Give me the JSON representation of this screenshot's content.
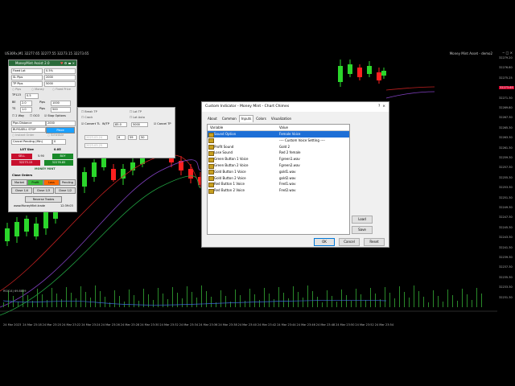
{
  "chart": {
    "header": "US30Rx,M1  32277.65 32277.55 32273.15 32273.65",
    "asset_title": "Money Mint Asset - demo2",
    "price_ticks": [
      "32279.20",
      "32276.80",
      "32275.25",
      "32273.65",
      "32271.30",
      "32269.80",
      "32267.30",
      "32265.30",
      "32263.30",
      "32261.30",
      "32259.30",
      "32257.30",
      "32255.30",
      "32253.30",
      "32251.30",
      "32249.30",
      "32247.30",
      "32245.30",
      "32243.30",
      "32241.30",
      "32239.30",
      "32237.30",
      "32235.30",
      "32233.30",
      "32231.30"
    ],
    "highlight_price": "32273.65",
    "time_ticks": [
      "24 Mar 2023",
      "24 Mar 23:18",
      "24 Mar 23:20",
      "24 Mar 23:22",
      "24 Mar 23:24",
      "24 Mar 23:26",
      "24 Mar 23:28",
      "24 Mar 23:30",
      "24 Mar 23:32",
      "24 Mar 23:34",
      "24 Mar 23:36",
      "24 Mar 23:38",
      "24 Mar 23:40",
      "24 Mar 23:42",
      "24 Mar 23:44",
      "24 Mar 23:46",
      "24 Mar 23:48",
      "24 Mar 23:50",
      "24 Mar 23:52",
      "24 Mar 23:54"
    ],
    "rsi_label": "RSI(14) 69.8809",
    "bull_color": "#2bd62b",
    "bear_color": "#ff2020"
  },
  "panel": {
    "title": "MoneyMint Assist 2.0",
    "fixed_lot_label": "Fixed Lot",
    "fixed_lot_value": "0.5%",
    "sl_label": "SL Pips",
    "sl_value": "2000",
    "tp_label": "TP Pips",
    "tp_value": "5000",
    "opt_pips": "Pips",
    "opt_money": "Money",
    "opt_fixed_price": "Fixed Price",
    "tp123_label": "TP123",
    "tp123_value": "0.5",
    "be_label": "BE",
    "be_value": "2.0",
    "pips_label": "Pips",
    "pips_value": "1000",
    "ts_label": "TS",
    "ts_value": "1.0",
    "pips2_value": "500",
    "two_way": "2 Way",
    "oco": "OCO",
    "stop_options": "Stop Options",
    "pips_distance_label": "Pips Distance",
    "pips_distance_value": "2000",
    "order_type": "BUY&SELL STOP",
    "place_label": "Place",
    "instant_order": "Instant Order",
    "schedule": "Schedule",
    "cancel_pending_label": "Cancel Pending (Min)",
    "cancel_pending_value": "0",
    "lot_size_label": "LOT Size",
    "lot_size_value": "0.05",
    "sell_label": "SELL",
    "spread": "5.90",
    "buy_label": "BUY",
    "sell_price": "32273.15",
    "buy_price": "32278.85",
    "close_orders_label": "Close Orders",
    "market_label": "Market",
    "profit_label": "Profit",
    "loss_label": "Loss",
    "pending_label": "Pending",
    "close_14": "Close 1/4",
    "close_13": "Close 1/3",
    "close_12": "Close 1/2",
    "reverse_trades": "Reverse Trades",
    "website": "www.MoneyMint.trade",
    "time": "12:39:03",
    "logo": "MONEY MINT"
  },
  "mini": {
    "break_tp": "Break TP",
    "cb2": "Crack",
    "cb3": "Lot TP",
    "cb4": "Lot Auto",
    "convert_tl": "Convert TL",
    "wtp_label": "W/TP",
    "wtp_value": "85.0",
    "v3": "5000",
    "cancel_tp": "Cancel TP",
    "d1": "2023.03.24",
    "d2": "2023.03.25",
    "h1": "8",
    "m1": "59",
    "s1": "50"
  },
  "dialog": {
    "title": "Custom Indicator - Money Mint - Chart Chimes",
    "close_icon": "×",
    "help_icon": "?",
    "tabs": [
      "About",
      "Common",
      "Inputs",
      "Colors",
      "Visualization"
    ],
    "active_tab": 2,
    "col_variable": "Variable",
    "col_value": "Value",
    "rows": [
      {
        "variable": "Sound Option",
        "value": "Female Voice",
        "selected": true
      },
      {
        "variable": "",
        "value": "---- Custom Voice Setting ----",
        "selected": false
      },
      {
        "variable": "Profit Sound",
        "value": "Gold 2",
        "selected": false
      },
      {
        "variable": "Lose Sound",
        "value": "Red 2 female",
        "selected": false
      },
      {
        "variable": "Green Button 1 Voice",
        "value": "Fgreen1.wav",
        "selected": false
      },
      {
        "variable": "Green Button 2 Voice",
        "value": "Fgreen2.wav",
        "selected": false
      },
      {
        "variable": "Gold Button 1 Voice",
        "value": "gold1.wav",
        "selected": false
      },
      {
        "variable": "Gold Button 2 Voice",
        "value": "gold2.wav",
        "selected": false
      },
      {
        "variable": "Red Button 1 Voice",
        "value": "Fred1.wav",
        "selected": false
      },
      {
        "variable": "Red Button 2 Voice",
        "value": "Fred2.wav",
        "selected": false
      }
    ],
    "load_label": "Load",
    "save_label": "Save",
    "ok_label": "OK",
    "cancel_label": "Cancel",
    "reset_label": "Reset"
  }
}
